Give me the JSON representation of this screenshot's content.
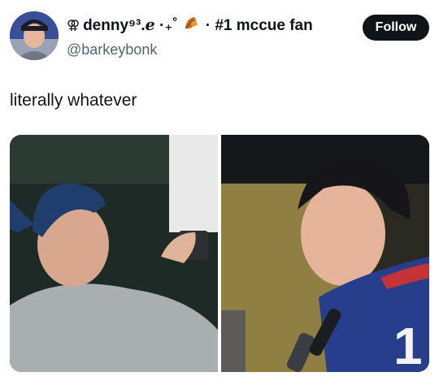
{
  "user": {
    "display_name_prefix": "⚢",
    "display_name": "denny⁹³.ℯ ·₊˚",
    "display_name_suffix": "· #1 mccue fan",
    "handle": "@barkeybonk",
    "avatar_icon": "profile-avatar"
  },
  "actions": {
    "follow_label": "Follow"
  },
  "tweet": {
    "text": "literally whatever"
  },
  "media": {
    "items": [
      "photo-player-in-cap-looking-up",
      "photo-player-in-jersey-interview"
    ]
  },
  "colors": {
    "text": "#0f1419",
    "secondary": "#536471",
    "button_bg": "#0f1419",
    "button_text": "#ffffff"
  }
}
